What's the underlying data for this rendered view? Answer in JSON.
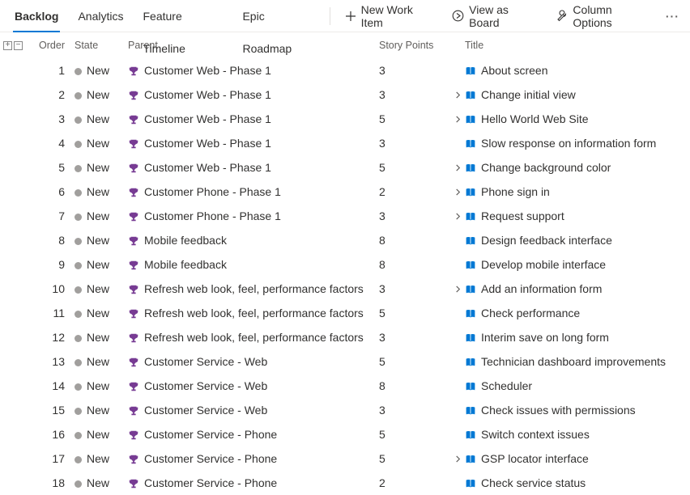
{
  "tabs": [
    {
      "label": "Backlog",
      "active": true
    },
    {
      "label": "Analytics",
      "active": false
    },
    {
      "label": "Feature Timeline",
      "active": false
    },
    {
      "label": "Epic Roadmap",
      "active": false
    }
  ],
  "commands": {
    "new_item": "New Work Item",
    "view_board": "View as Board",
    "column_options": "Column Options"
  },
  "columns": {
    "order": "Order",
    "state": "State",
    "parent": "Parent",
    "points": "Story Points",
    "title": "Title"
  },
  "colors": {
    "epic_icon": "#773b93",
    "story_icon": "#0078d4",
    "state_dot": "#a19f9d",
    "accent": "#0078d4"
  },
  "rows": [
    {
      "order": 1,
      "state": "New",
      "parent": "Customer Web - Phase 1",
      "points": 3,
      "title": "About screen",
      "expandable": false
    },
    {
      "order": 2,
      "state": "New",
      "parent": "Customer Web - Phase 1",
      "points": 3,
      "title": "Change initial view",
      "expandable": true
    },
    {
      "order": 3,
      "state": "New",
      "parent": "Customer Web - Phase 1",
      "points": 5,
      "title": "Hello World Web Site",
      "expandable": true
    },
    {
      "order": 4,
      "state": "New",
      "parent": "Customer Web - Phase 1",
      "points": 3,
      "title": "Slow response on information form",
      "expandable": false
    },
    {
      "order": 5,
      "state": "New",
      "parent": "Customer Web - Phase 1",
      "points": 5,
      "title": "Change background color",
      "expandable": true
    },
    {
      "order": 6,
      "state": "New",
      "parent": "Customer Phone - Phase 1",
      "points": 2,
      "title": "Phone sign in",
      "expandable": true
    },
    {
      "order": 7,
      "state": "New",
      "parent": "Customer Phone - Phase 1",
      "points": 3,
      "title": "Request support",
      "expandable": true
    },
    {
      "order": 8,
      "state": "New",
      "parent": "Mobile feedback",
      "points": 8,
      "title": "Design feedback interface",
      "expandable": false
    },
    {
      "order": 9,
      "state": "New",
      "parent": "Mobile feedback",
      "points": 8,
      "title": "Develop mobile interface",
      "expandable": false
    },
    {
      "order": 10,
      "state": "New",
      "parent": "Refresh web look, feel, performance factors",
      "points": 3,
      "title": "Add an information form",
      "expandable": true
    },
    {
      "order": 11,
      "state": "New",
      "parent": "Refresh web look, feel, performance factors",
      "points": 5,
      "title": "Check performance",
      "expandable": false
    },
    {
      "order": 12,
      "state": "New",
      "parent": "Refresh web look, feel, performance factors",
      "points": 3,
      "title": "Interim save on long form",
      "expandable": false
    },
    {
      "order": 13,
      "state": "New",
      "parent": "Customer Service - Web",
      "points": 5,
      "title": "Technician dashboard improvements",
      "expandable": false
    },
    {
      "order": 14,
      "state": "New",
      "parent": "Customer Service - Web",
      "points": 8,
      "title": "Scheduler",
      "expandable": false
    },
    {
      "order": 15,
      "state": "New",
      "parent": "Customer Service - Web",
      "points": 3,
      "title": "Check issues with permissions",
      "expandable": false
    },
    {
      "order": 16,
      "state": "New",
      "parent": "Customer Service - Phone",
      "points": 5,
      "title": "Switch context issues",
      "expandable": false
    },
    {
      "order": 17,
      "state": "New",
      "parent": "Customer Service - Phone",
      "points": 5,
      "title": "GSP locator interface",
      "expandable": true
    },
    {
      "order": 18,
      "state": "New",
      "parent": "Customer Service - Phone",
      "points": 2,
      "title": "Check service status",
      "expandable": false
    }
  ]
}
